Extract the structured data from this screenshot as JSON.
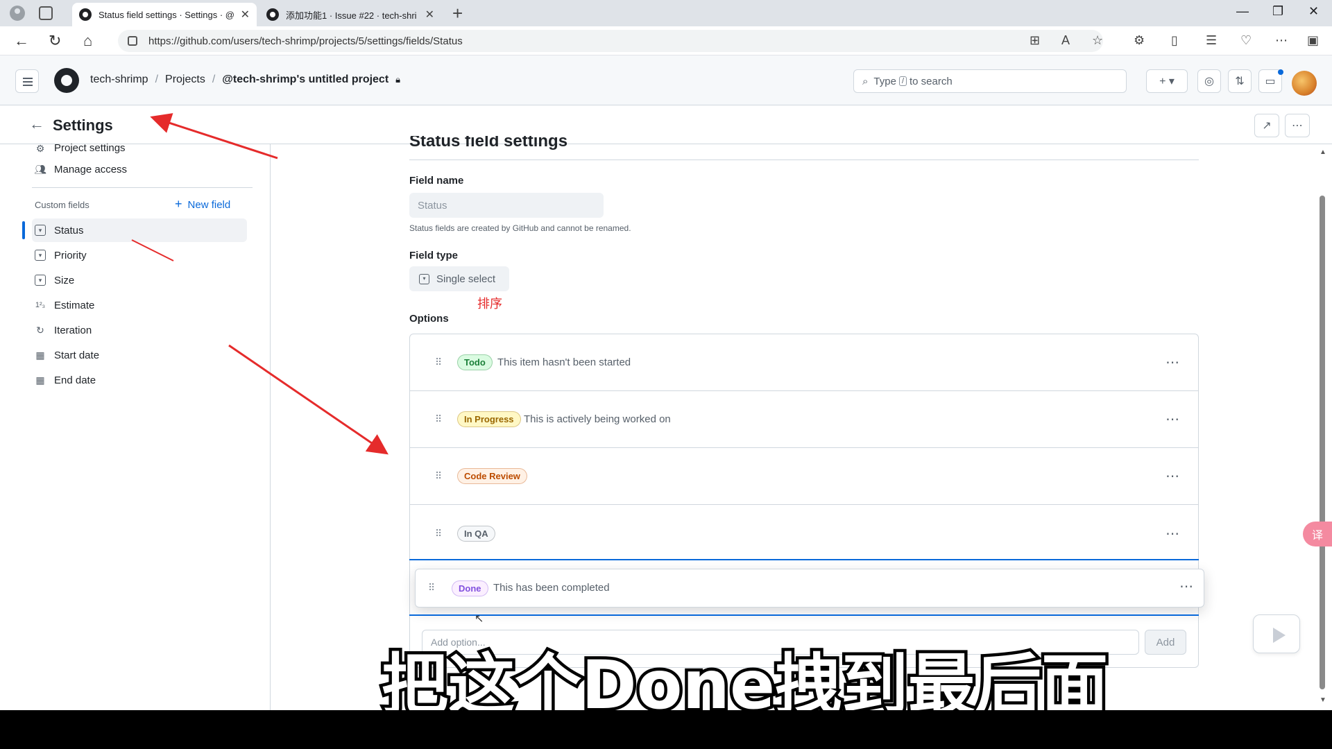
{
  "browser": {
    "active_tab": "Status field settings · Settings · @",
    "inactive_tab": "添加功能1 · Issue #22 · tech-shri",
    "url": "https://github.com/users/tech-shrimp/projects/5/settings/fields/Status"
  },
  "header": {
    "owner": "tech-shrimp",
    "projects": "Projects",
    "project_name": "@tech-shrimp's untitled project",
    "search_pre": "Type",
    "search_key": "/",
    "search_post": "to search"
  },
  "settings": {
    "title": "Settings"
  },
  "sidebar": {
    "project_settings": "Project settings",
    "manage_access": "Manage access",
    "custom_fields_label": "Custom fields",
    "new_field": "New field",
    "fields": [
      {
        "label": "Status",
        "icon": "single-select-icon"
      },
      {
        "label": "Priority",
        "icon": "single-select-icon"
      },
      {
        "label": "Size",
        "icon": "single-select-icon"
      },
      {
        "label": "Estimate",
        "icon": "number-icon"
      },
      {
        "label": "Iteration",
        "icon": "iteration-icon"
      },
      {
        "label": "Start date",
        "icon": "calendar-icon"
      },
      {
        "label": "End date",
        "icon": "calendar-icon"
      }
    ]
  },
  "main": {
    "title": "Status field settings",
    "field_name_label": "Field name",
    "field_name_value": "Status",
    "field_name_hint": "Status fields are created by GitHub and cannot be renamed.",
    "field_type_label": "Field type",
    "field_type_value": "Single select",
    "annotation": "排序",
    "options_label": "Options",
    "options": [
      {
        "name": "Todo",
        "description": "This item hasn't been started",
        "color": "#1a7f37",
        "bg": "#dafbe1"
      },
      {
        "name": "In Progress",
        "description": "This is actively being worked on",
        "color": "#9a6700",
        "bg": "#fff8c5"
      },
      {
        "name": "Code Review",
        "description": "",
        "color": "#bc4c00",
        "bg": "#fff1e5"
      },
      {
        "name": "In QA",
        "description": "",
        "color": "#57606a",
        "bg": "#f6f8fa"
      }
    ],
    "dragging_option": {
      "name": "Done",
      "description": "This has been completed",
      "color": "#8250df",
      "bg": "#fbefff"
    },
    "add_option_placeholder": "Add option...",
    "add_button": "Add"
  },
  "caption": "把这个Done拽到最后面",
  "colors": {
    "accent": "#0969da",
    "annotation_red": "#e52b2b"
  }
}
